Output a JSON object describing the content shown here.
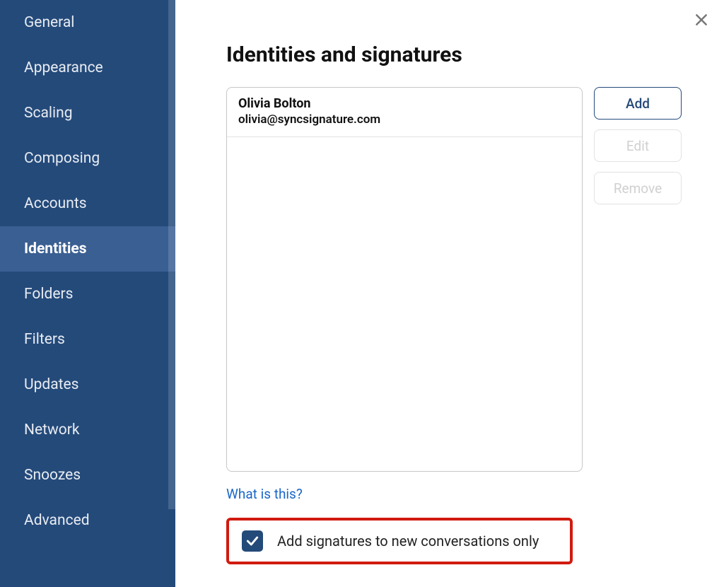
{
  "sidebar": {
    "items": [
      {
        "label": "General"
      },
      {
        "label": "Appearance"
      },
      {
        "label": "Scaling"
      },
      {
        "label": "Composing"
      },
      {
        "label": "Accounts"
      },
      {
        "label": "Identities",
        "active": true
      },
      {
        "label": "Folders"
      },
      {
        "label": "Filters"
      },
      {
        "label": "Updates"
      },
      {
        "label": "Network"
      },
      {
        "label": "Snoozes"
      },
      {
        "label": "Advanced"
      }
    ]
  },
  "main": {
    "title": "Identities and signatures",
    "identities": [
      {
        "name": "Olivia Bolton",
        "email": "olivia@syncsignature.com"
      }
    ],
    "buttons": {
      "add": "Add",
      "edit": "Edit",
      "remove": "Remove"
    },
    "help_link": "What is this?",
    "checkbox_label": "Add signatures to new conversations only",
    "checkbox_checked": true
  }
}
